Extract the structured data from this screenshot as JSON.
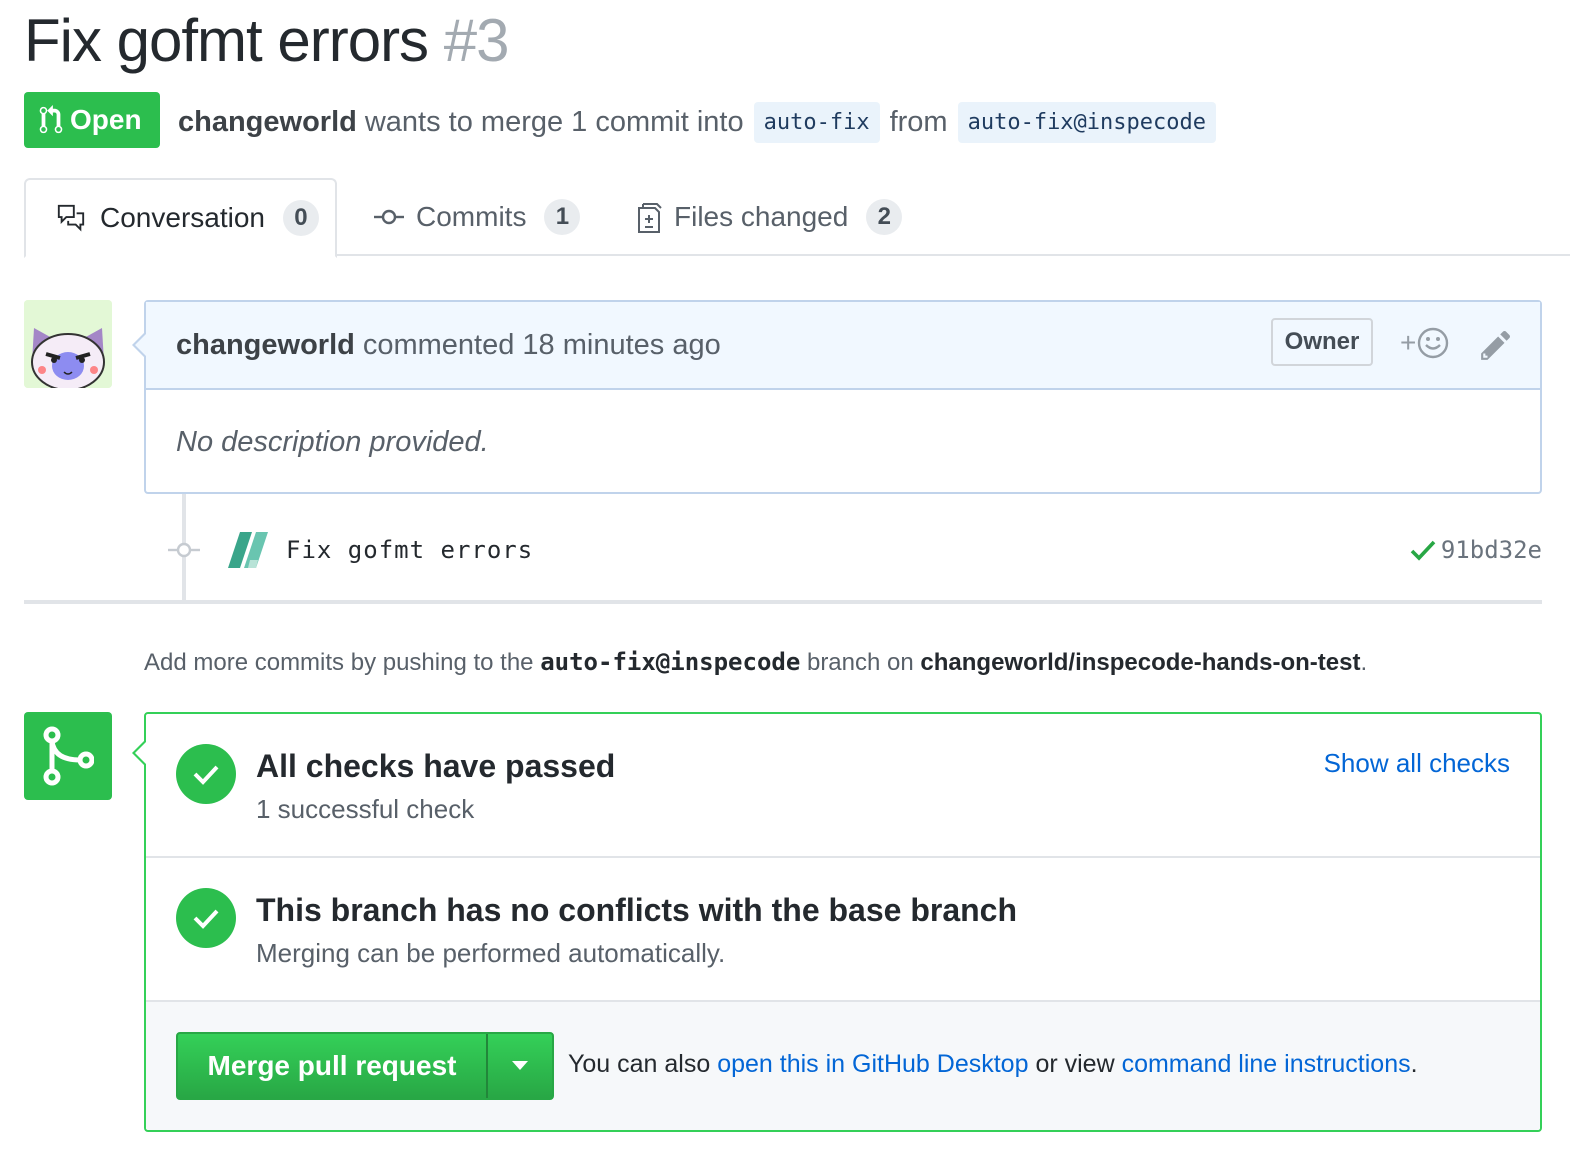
{
  "pr": {
    "title": "Fix gofmt errors",
    "number": "#3",
    "state_label": "Open",
    "author": "changeworld",
    "merge_text": "wants to merge 1 commit into",
    "base_branch": "auto-fix",
    "from_text": "from",
    "head_branch": "auto-fix@inspecode"
  },
  "tabs": [
    {
      "label": "Conversation",
      "count": "0"
    },
    {
      "label": "Commits",
      "count": "1"
    },
    {
      "label": "Files changed",
      "count": "2"
    }
  ],
  "comment": {
    "author": "changeworld",
    "action": "commented 18 minutes ago",
    "badge": "Owner",
    "react_plus": "+",
    "body": "No description provided."
  },
  "commit": {
    "message": "Fix gofmt errors",
    "sha": "91bd32e"
  },
  "hint": {
    "prefix": "Add more commits by pushing to the",
    "branch": "auto-fix@inspecode",
    "middle": "branch on",
    "repo": "changeworld/inspecode-hands-on-test",
    "suffix": "."
  },
  "merge": {
    "checks_title": "All checks have passed",
    "checks_sub": "1 successful check",
    "show_all": "Show all checks",
    "conflict_title": "This branch has no conflicts with the base branch",
    "conflict_sub": "Merging can be performed automatically.",
    "button": "Merge pull request",
    "footer_prefix": "You can also",
    "footer_link1": "open this in GitHub Desktop",
    "footer_mid": "or view",
    "footer_link2": "command line instructions",
    "footer_suffix": "."
  },
  "colors": {
    "green": "#2cbe4e",
    "link": "#0366d6",
    "comment_header": "#f1f8ff"
  }
}
